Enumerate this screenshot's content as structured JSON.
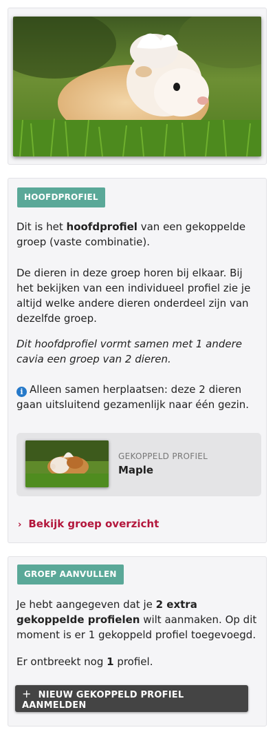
{
  "photo": {
    "alt": "Cavia in het gras"
  },
  "main": {
    "badge": "HOOFDPROFIEL",
    "intro_pre": "Dit is het ",
    "intro_bold": "hoofdprofiel",
    "intro_post": " van een gekoppelde groep (vaste combinatie).",
    "description": "De dieren in deze groep horen bij elkaar. Bij het bekijken van een individueel profiel zie je altijd welke andere dieren onderdeel zijn van dezelfde groep.",
    "summary": "Dit hoofdprofiel vormt samen met 1 andere cavia een groep van 2 dieren.",
    "info_icon": "i",
    "info_text": "Alleen samen herplaatsen: deze 2 dieren gaan uitsluitend gezamenlijk naar één gezin.",
    "linked_profile": {
      "label": "GEKOPPELD PROFIEL",
      "name": "Maple"
    },
    "group_link": {
      "chevron": "›",
      "label": "Bekijk groep overzicht"
    }
  },
  "group": {
    "badge": "GROEP AANVULLEN",
    "text_pre": "Je hebt aangegeven dat je ",
    "text_bold": "2 extra gekoppelde profielen",
    "text_post": " wilt aanmaken. Op dit moment is er 1 gekoppeld profiel toegevoegd.",
    "missing_pre": "Er ontbreekt nog ",
    "missing_count": "1",
    "missing_post": " profiel.",
    "button_icon": "+",
    "button_label": "NIEUW GEKOPPELD PROFIEL AANMELDEN"
  },
  "colors": {
    "accent": "#5aa898",
    "link": "#b3173c",
    "info": "#2679c9",
    "button": "#444444"
  }
}
